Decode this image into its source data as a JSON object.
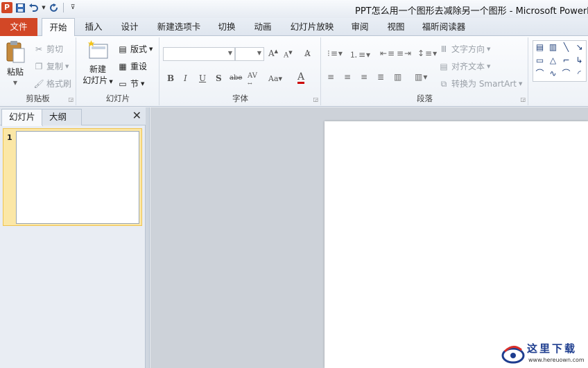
{
  "window": {
    "title": "PPT怎么用一个图形去减除另一个图形 - Microsoft PowerPoint",
    "app_icon": "P"
  },
  "quick_access": [
    {
      "name": "save-icon",
      "glyph": "💾"
    },
    {
      "name": "undo-icon",
      "glyph": "↶"
    },
    {
      "name": "redo-icon",
      "glyph": "↻"
    },
    {
      "name": "customize-icon",
      "glyph": "⊽"
    }
  ],
  "tabs": [
    {
      "label": "文件",
      "active": false
    },
    {
      "label": "开始",
      "active": true
    },
    {
      "label": "插入",
      "active": false
    },
    {
      "label": "设计",
      "active": false
    },
    {
      "label": "新建选项卡",
      "active": false
    },
    {
      "label": "切换",
      "active": false
    },
    {
      "label": "动画",
      "active": false
    },
    {
      "label": "幻灯片放映",
      "active": false
    },
    {
      "label": "审阅",
      "active": false
    },
    {
      "label": "视图",
      "active": false
    },
    {
      "label": "福昕阅读器",
      "active": false
    }
  ],
  "ribbon": {
    "clipboard": {
      "label": "剪贴板",
      "paste": "粘贴",
      "cut": "剪切",
      "copy": "复制",
      "format_painter": "格式刷"
    },
    "slides": {
      "label": "幻灯片",
      "new_slide_line1": "新建",
      "new_slide_line2": "幻灯片",
      "layout": "版式",
      "reset": "重设",
      "section": "节"
    },
    "font": {
      "label": "字体",
      "font_name": "",
      "font_size": ""
    },
    "paragraph": {
      "label": "段落",
      "text_direction": "文字方向",
      "align_text": "对齐文本",
      "convert_smartart": "转换为 SmartArt"
    }
  },
  "panel": {
    "tab_slides": "幻灯片",
    "tab_outline": "大纲",
    "close": "✕",
    "slide_number": "1"
  },
  "watermark": {
    "text_cn": "这里下载",
    "url": "www.hereuown.com"
  },
  "colors": {
    "file_tab": "#d24726",
    "selection": "#fbe7a6",
    "editor_bg": "#cdd2d9"
  }
}
